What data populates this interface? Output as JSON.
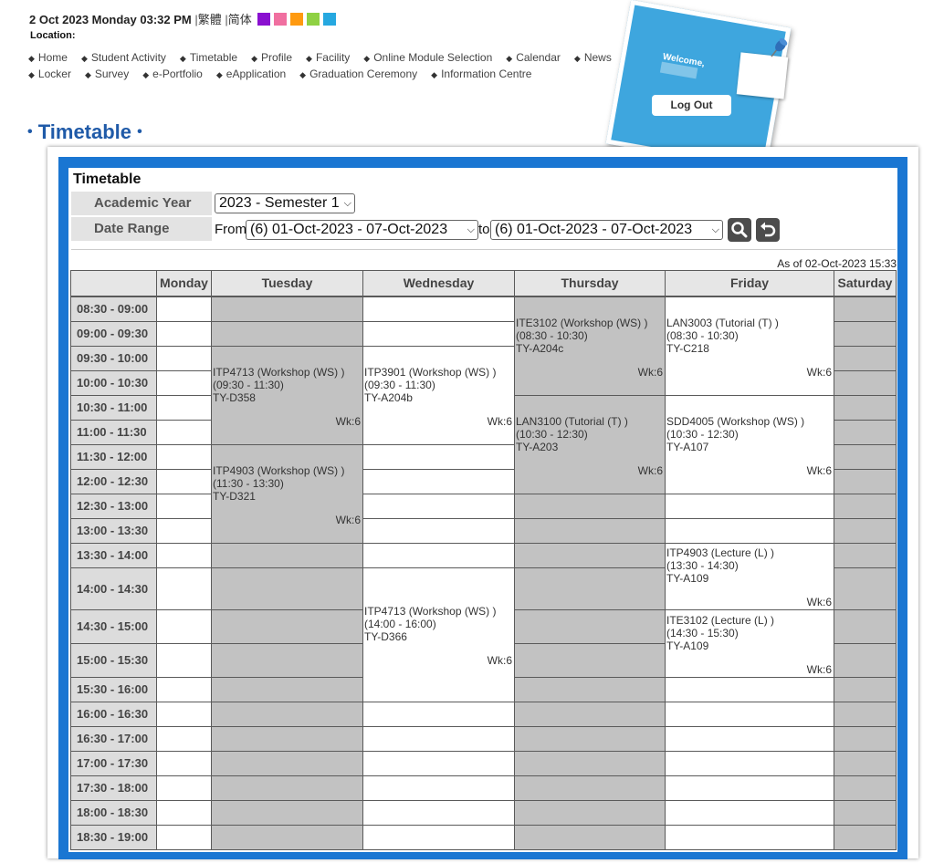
{
  "header": {
    "datetime": "2 Oct 2023 Monday 03:32 PM",
    "sep": "|",
    "lang_traditional": "繁體",
    "lang_simplified": "简体",
    "theme_colors": [
      "#8a10d0",
      "#f06fa0",
      "#ff9a10",
      "#8fd143",
      "#26a8e0"
    ],
    "location_label": "Location:"
  },
  "nav": {
    "row1": [
      "Home",
      "Student Activity",
      "Timetable",
      "Profile",
      "Facility",
      "Online Module Selection",
      "Calendar",
      "News"
    ],
    "row2": [
      "Locker",
      "Survey",
      "e-Portfolio",
      "eApplication",
      "Graduation Ceremony",
      "Information Centre"
    ]
  },
  "welcome": {
    "greeting": "Welcome,",
    "logout_label": "Log Out"
  },
  "page": {
    "title": "Timetable",
    "dot": "•"
  },
  "form": {
    "heading": "Timetable",
    "academic_year_label": "Academic Year",
    "academic_year_value": "2023 - Semester 1",
    "date_range_label": "Date Range",
    "from_label": "From",
    "from_value": "(6) 01-Oct-2023 - 07-Oct-2023",
    "to_label": "to",
    "to_value": "(6) 01-Oct-2023 - 07-Oct-2023",
    "as_of": "As of 02-Oct-2023 15:33"
  },
  "timetable": {
    "days": [
      "Monday",
      "Tuesday",
      "Wednesday",
      "Thursday",
      "Friday",
      "Saturday"
    ],
    "slots": [
      "08:30 - 09:00",
      "09:00 - 09:30",
      "09:30 - 10:00",
      "10:00 - 10:30",
      "10:30 - 11:00",
      "11:00 - 11:30",
      "11:30 - 12:00",
      "12:00 - 12:30",
      "12:30 - 13:00",
      "13:00 - 13:30",
      "13:30 - 14:00",
      "14:00 - 14:30",
      "14:30 - 15:00",
      "15:00 - 15:30",
      "15:30 - 16:00",
      "16:00 - 16:30",
      "16:30 - 17:00",
      "17:00 - 17:30",
      "17:30 - 18:00",
      "18:00 - 18:30",
      "18:30 - 19:00"
    ],
    "shaded": {
      "Monday": [],
      "Tuesday": [
        0,
        1,
        2,
        3,
        4,
        5,
        6,
        7,
        8,
        9,
        10,
        11,
        12,
        13,
        14,
        15,
        16,
        17,
        18,
        19,
        20
      ],
      "Wednesday": [],
      "Thursday": [
        8,
        9,
        10,
        11,
        12,
        13,
        14,
        15,
        16,
        17,
        18,
        19,
        20
      ],
      "Friday": [],
      "Saturday": [
        0,
        1,
        2,
        3,
        4,
        5,
        6,
        7,
        8,
        9,
        10,
        11,
        12,
        13,
        14,
        15,
        16,
        17,
        18,
        19,
        20
      ]
    },
    "courses": [
      {
        "day": "Tuesday",
        "start": 2,
        "span": 4,
        "code": "ITP4713 (Workshop (WS) )",
        "time": "(09:30 - 11:30)",
        "room": "TY-D358",
        "week": "Wk:6",
        "shaded": true
      },
      {
        "day": "Tuesday",
        "start": 6,
        "span": 4,
        "code": "ITP4903 (Workshop (WS) )",
        "time": "(11:30 - 13:30)",
        "room": "TY-D321",
        "week": "Wk:6",
        "shaded": true
      },
      {
        "day": "Wednesday",
        "start": 2,
        "span": 4,
        "code": "ITP3901 (Workshop (WS) )",
        "time": "(09:30 - 11:30)",
        "room": "TY-A204b",
        "week": "Wk:6",
        "shaded": false
      },
      {
        "day": "Wednesday",
        "start": 11,
        "span": 4,
        "code": "ITP4713 (Workshop (WS) )",
        "time": "(14:00 - 16:00)",
        "room": "TY-D366",
        "week": "Wk:6",
        "shaded": false
      },
      {
        "day": "Thursday",
        "start": 0,
        "span": 4,
        "code": "ITE3102 (Workshop (WS) )",
        "time": "(08:30 - 10:30)",
        "room": "TY-A204c",
        "week": "Wk:6",
        "shaded": true
      },
      {
        "day": "Thursday",
        "start": 4,
        "span": 4,
        "code": "LAN3100 (Tutorial (T) )",
        "time": "(10:30 - 12:30)",
        "room": "TY-A203",
        "week": "Wk:6",
        "shaded": true
      },
      {
        "day": "Friday",
        "start": 0,
        "span": 4,
        "code": "LAN3003 (Tutorial (T) )",
        "time": "(08:30 - 10:30)",
        "room": "TY-C218",
        "week": "Wk:6",
        "shaded": false
      },
      {
        "day": "Friday",
        "start": 4,
        "span": 4,
        "code": "SDD4005 (Workshop (WS) )",
        "time": "(10:30 - 12:30)",
        "room": "TY-A107",
        "week": "Wk:6",
        "shaded": false
      },
      {
        "day": "Friday",
        "start": 10,
        "span": 2,
        "code": "ITP4903 (Lecture (L) )",
        "time": "(13:30 - 14:30)",
        "room": "TY-A109",
        "week": "Wk:6",
        "shaded": false
      },
      {
        "day": "Friday",
        "start": 12,
        "span": 2,
        "code": "ITE3102 (Lecture (L) )",
        "time": "(14:30 - 15:30)",
        "room": "TY-A109",
        "week": "Wk:6",
        "shaded": false
      }
    ]
  }
}
